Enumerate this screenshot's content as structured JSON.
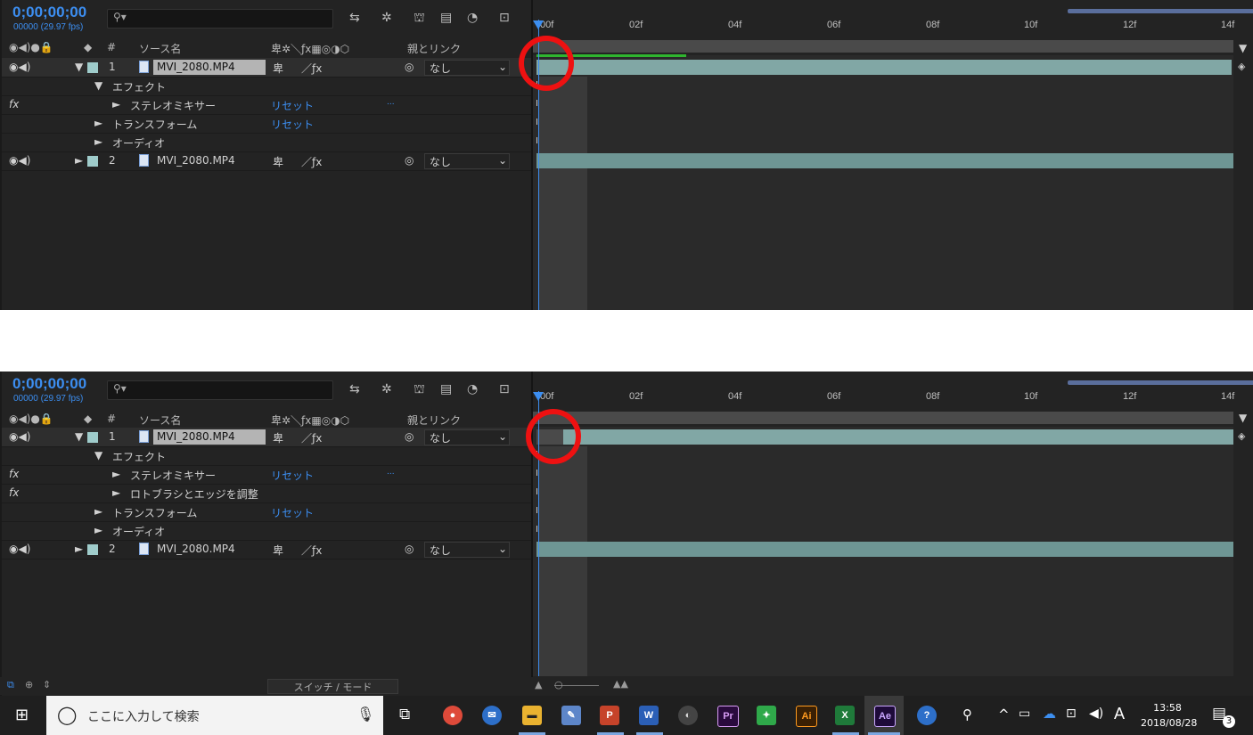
{
  "timecode": "0;00;00;00",
  "fps": "00000 (29.97 fps)",
  "columns": {
    "num": "#",
    "source": "ソース名",
    "parent": "親とリンク"
  },
  "ruler": [
    "00f",
    "02f",
    "04f",
    "06f",
    "08f",
    "10f",
    "12f",
    "14f"
  ],
  "top": {
    "layers": [
      {
        "num": "1",
        "name": "MVI_2080.MP4",
        "parent": "なし"
      },
      {
        "num": "2",
        "name": "MVI_2080.MP4",
        "parent": "なし"
      }
    ],
    "effects_label": "エフェクト",
    "stereo": "ステレオミキサー",
    "transform": "トランスフォーム",
    "audio": "オーディオ",
    "reset": "リセット",
    "dots": "...",
    "fx": "fx"
  },
  "bottom": {
    "layers": [
      {
        "num": "1",
        "name": "MVI_2080.MP4",
        "parent": "なし"
      },
      {
        "num": "2",
        "name": "MVI_2080.MP4",
        "parent": "なし"
      }
    ],
    "effects_label": "エフェクト",
    "stereo": "ステレオミキサー",
    "roto": "ロトブラシとエッジを調整",
    "transform": "トランスフォーム",
    "audio": "オーディオ",
    "reset": "リセット",
    "dots": "...",
    "fx": "fx"
  },
  "status_bar": {
    "switch_mode": "スイッチ / モード"
  },
  "taskbar": {
    "search_placeholder": "ここに入力して検索",
    "apps": [
      "Pr",
      "Ai",
      "Ae"
    ],
    "ime": "A",
    "time": "13:58",
    "date": "2018/08/28",
    "notifications": "3"
  },
  "colors": {
    "accent": "#3c8ef1",
    "layer_label": "#9fcccb",
    "highlight": "#ee1111"
  }
}
